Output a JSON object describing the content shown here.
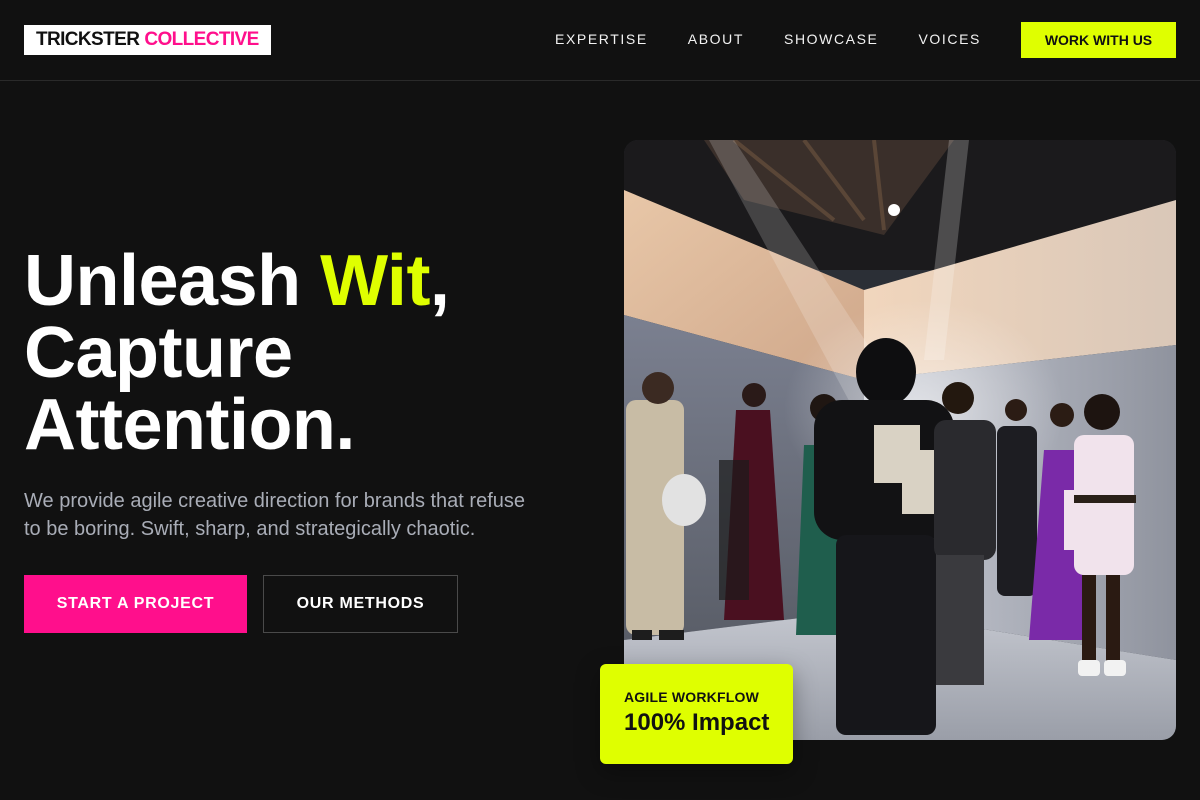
{
  "brand": {
    "name_part1": "TRICKSTER",
    "name_part2": "COLLECTIVE",
    "accent_pink": "#ff0f8c",
    "accent_lime": "#dfff00"
  },
  "nav": {
    "links": [
      {
        "label": "EXPERTISE"
      },
      {
        "label": "ABOUT"
      },
      {
        "label": "SHOWCASE"
      },
      {
        "label": "VOICES"
      }
    ],
    "cta_label": "WORK WITH US"
  },
  "hero": {
    "title_word1": "Unleash",
    "title_highlight": "Wit",
    "title_comma": ",",
    "title_line2": "Capture",
    "title_line3": "Attention.",
    "subtitle": "We provide agile creative direction for brands that refuse to be boring. Swift, sharp, and strategically chaotic.",
    "primary_button": "START A PROJECT",
    "secondary_button": "OUR METHODS",
    "image_description_icon": "fashion-event-photo"
  },
  "stat_card": {
    "label": "AGILE WORKFLOW",
    "value": "100% Impact"
  }
}
